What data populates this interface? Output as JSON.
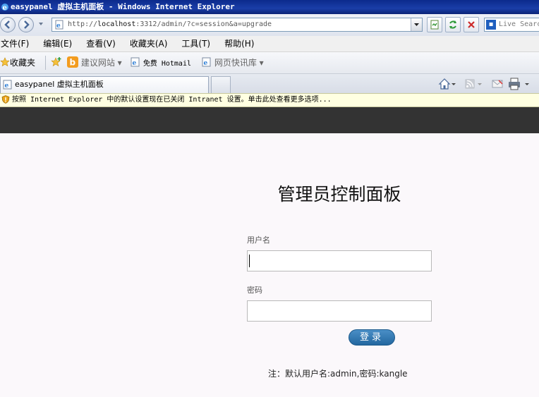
{
  "window": {
    "title": "easypanel 虚拟主机面板 - Windows Internet Explorer"
  },
  "address": {
    "url_prefix": "http://",
    "url_host": "localhost",
    "url_rest": ":3312/admin/?c=session&a=upgrade"
  },
  "search": {
    "placeholder": "Live Search"
  },
  "menu": [
    "文件(F)",
    "编辑(E)",
    "查看(V)",
    "收藏夹(A)",
    "工具(T)",
    "帮助(H)"
  ],
  "favorites": {
    "label": "收藏夹",
    "suggested": "建议网站",
    "hotmail": "免费 Hotmail",
    "webslice": "网页快讯库"
  },
  "tab": {
    "title": "easypanel 虚拟主机面板"
  },
  "infobar": {
    "text": "按照 Internet Explorer 中的默认设置现在已关闭 Intranet 设置。单击此处查看更多选项..."
  },
  "login": {
    "heading": "管理员控制面板",
    "username_label": "用户名",
    "username_value": "",
    "password_label": "密码",
    "password_value": "",
    "submit_label": "登录",
    "note": "注：默认用户名:admin,密码:kangle"
  },
  "colors": {
    "titlebar": "#0b2a8c",
    "header_bar": "#333333",
    "button": "#2e77b2",
    "page_bg": "#fbf8fb"
  }
}
